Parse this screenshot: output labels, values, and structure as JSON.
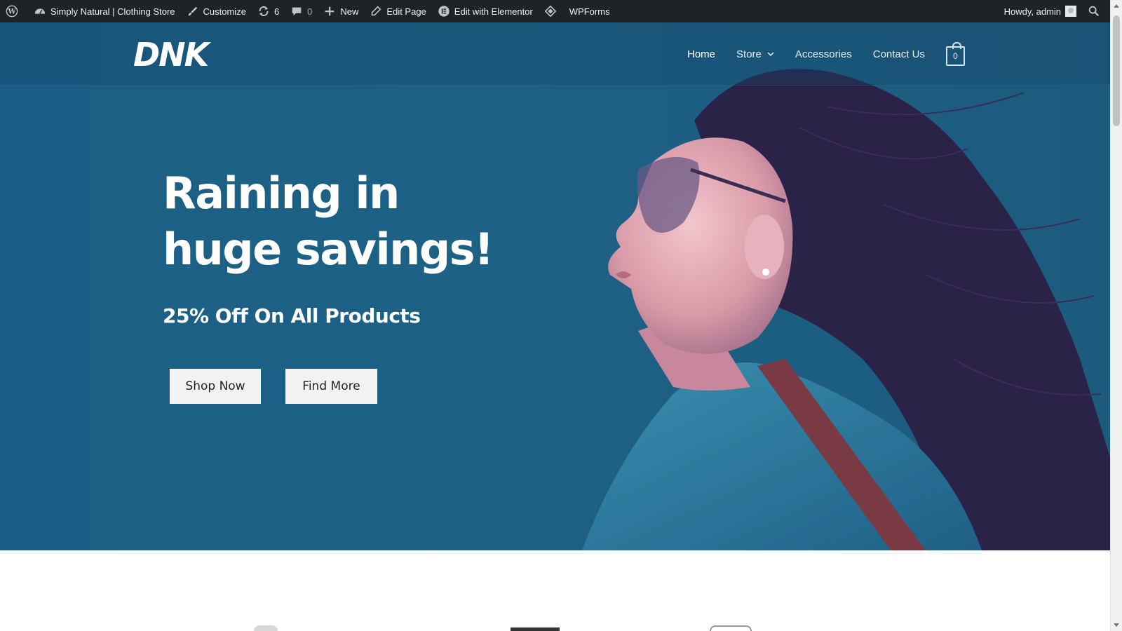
{
  "adminbar": {
    "site_name": "Simply Natural | Clothing Store",
    "customize": "Customize",
    "updates_count": "6",
    "comments_count": "0",
    "new": "New",
    "edit_page": "Edit Page",
    "edit_elementor": "Edit with Elementor",
    "wpforms": "WPForms",
    "howdy": "Howdy, admin"
  },
  "header": {
    "logo_text": "DNK",
    "nav": [
      {
        "label": "Home"
      },
      {
        "label": "Store"
      },
      {
        "label": "Accessories"
      },
      {
        "label": "Contact Us"
      }
    ],
    "cart_count": "0"
  },
  "hero": {
    "headline": "Raining in huge savings!",
    "subheadline": "25% Off On All Products",
    "primary_button": "Shop Now",
    "secondary_button": "Find More"
  },
  "colors": {
    "adminbar_bg": "#1d2327",
    "hero_bg": "#1d6185",
    "button_bg": "#f2f2f2"
  }
}
